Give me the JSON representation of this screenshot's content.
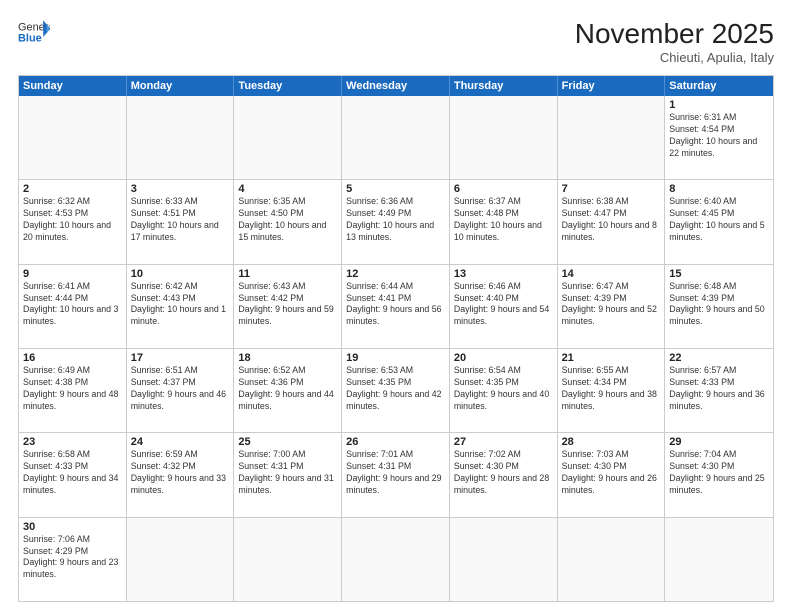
{
  "header": {
    "logo_general": "General",
    "logo_blue": "Blue",
    "month_year": "November 2025",
    "subtitle": "Chieuti, Apulia, Italy"
  },
  "weekdays": [
    "Sunday",
    "Monday",
    "Tuesday",
    "Wednesday",
    "Thursday",
    "Friday",
    "Saturday"
  ],
  "rows": [
    [
      {
        "day": "",
        "info": ""
      },
      {
        "day": "",
        "info": ""
      },
      {
        "day": "",
        "info": ""
      },
      {
        "day": "",
        "info": ""
      },
      {
        "day": "",
        "info": ""
      },
      {
        "day": "",
        "info": ""
      },
      {
        "day": "1",
        "info": "Sunrise: 6:31 AM\nSunset: 4:54 PM\nDaylight: 10 hours and 22 minutes."
      }
    ],
    [
      {
        "day": "2",
        "info": "Sunrise: 6:32 AM\nSunset: 4:53 PM\nDaylight: 10 hours and 20 minutes."
      },
      {
        "day": "3",
        "info": "Sunrise: 6:33 AM\nSunset: 4:51 PM\nDaylight: 10 hours and 17 minutes."
      },
      {
        "day": "4",
        "info": "Sunrise: 6:35 AM\nSunset: 4:50 PM\nDaylight: 10 hours and 15 minutes."
      },
      {
        "day": "5",
        "info": "Sunrise: 6:36 AM\nSunset: 4:49 PM\nDaylight: 10 hours and 13 minutes."
      },
      {
        "day": "6",
        "info": "Sunrise: 6:37 AM\nSunset: 4:48 PM\nDaylight: 10 hours and 10 minutes."
      },
      {
        "day": "7",
        "info": "Sunrise: 6:38 AM\nSunset: 4:47 PM\nDaylight: 10 hours and 8 minutes."
      },
      {
        "day": "8",
        "info": "Sunrise: 6:40 AM\nSunset: 4:45 PM\nDaylight: 10 hours and 5 minutes."
      }
    ],
    [
      {
        "day": "9",
        "info": "Sunrise: 6:41 AM\nSunset: 4:44 PM\nDaylight: 10 hours and 3 minutes."
      },
      {
        "day": "10",
        "info": "Sunrise: 6:42 AM\nSunset: 4:43 PM\nDaylight: 10 hours and 1 minute."
      },
      {
        "day": "11",
        "info": "Sunrise: 6:43 AM\nSunset: 4:42 PM\nDaylight: 9 hours and 59 minutes."
      },
      {
        "day": "12",
        "info": "Sunrise: 6:44 AM\nSunset: 4:41 PM\nDaylight: 9 hours and 56 minutes."
      },
      {
        "day": "13",
        "info": "Sunrise: 6:46 AM\nSunset: 4:40 PM\nDaylight: 9 hours and 54 minutes."
      },
      {
        "day": "14",
        "info": "Sunrise: 6:47 AM\nSunset: 4:39 PM\nDaylight: 9 hours and 52 minutes."
      },
      {
        "day": "15",
        "info": "Sunrise: 6:48 AM\nSunset: 4:39 PM\nDaylight: 9 hours and 50 minutes."
      }
    ],
    [
      {
        "day": "16",
        "info": "Sunrise: 6:49 AM\nSunset: 4:38 PM\nDaylight: 9 hours and 48 minutes."
      },
      {
        "day": "17",
        "info": "Sunrise: 6:51 AM\nSunset: 4:37 PM\nDaylight: 9 hours and 46 minutes."
      },
      {
        "day": "18",
        "info": "Sunrise: 6:52 AM\nSunset: 4:36 PM\nDaylight: 9 hours and 44 minutes."
      },
      {
        "day": "19",
        "info": "Sunrise: 6:53 AM\nSunset: 4:35 PM\nDaylight: 9 hours and 42 minutes."
      },
      {
        "day": "20",
        "info": "Sunrise: 6:54 AM\nSunset: 4:35 PM\nDaylight: 9 hours and 40 minutes."
      },
      {
        "day": "21",
        "info": "Sunrise: 6:55 AM\nSunset: 4:34 PM\nDaylight: 9 hours and 38 minutes."
      },
      {
        "day": "22",
        "info": "Sunrise: 6:57 AM\nSunset: 4:33 PM\nDaylight: 9 hours and 36 minutes."
      }
    ],
    [
      {
        "day": "23",
        "info": "Sunrise: 6:58 AM\nSunset: 4:33 PM\nDaylight: 9 hours and 34 minutes."
      },
      {
        "day": "24",
        "info": "Sunrise: 6:59 AM\nSunset: 4:32 PM\nDaylight: 9 hours and 33 minutes."
      },
      {
        "day": "25",
        "info": "Sunrise: 7:00 AM\nSunset: 4:31 PM\nDaylight: 9 hours and 31 minutes."
      },
      {
        "day": "26",
        "info": "Sunrise: 7:01 AM\nSunset: 4:31 PM\nDaylight: 9 hours and 29 minutes."
      },
      {
        "day": "27",
        "info": "Sunrise: 7:02 AM\nSunset: 4:30 PM\nDaylight: 9 hours and 28 minutes."
      },
      {
        "day": "28",
        "info": "Sunrise: 7:03 AM\nSunset: 4:30 PM\nDaylight: 9 hours and 26 minutes."
      },
      {
        "day": "29",
        "info": "Sunrise: 7:04 AM\nSunset: 4:30 PM\nDaylight: 9 hours and 25 minutes."
      }
    ],
    [
      {
        "day": "30",
        "info": "Sunrise: 7:06 AM\nSunset: 4:29 PM\nDaylight: 9 hours and 23 minutes."
      },
      {
        "day": "",
        "info": ""
      },
      {
        "day": "",
        "info": ""
      },
      {
        "day": "",
        "info": ""
      },
      {
        "day": "",
        "info": ""
      },
      {
        "day": "",
        "info": ""
      },
      {
        "day": "",
        "info": ""
      }
    ]
  ]
}
